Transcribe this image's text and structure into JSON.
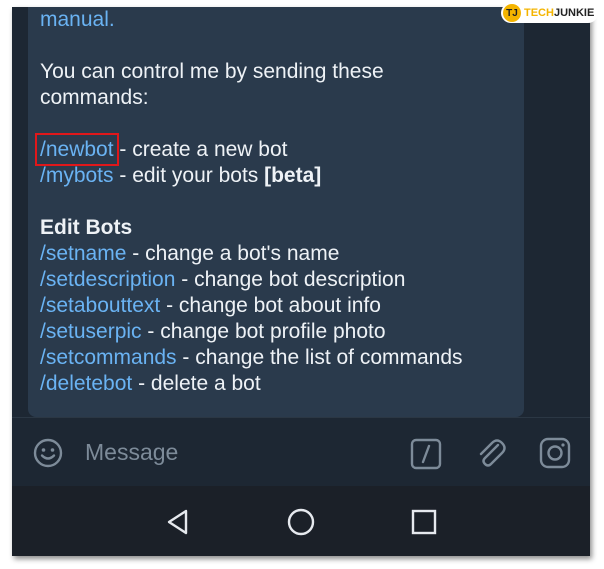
{
  "logo": {
    "badge": "TJ",
    "part1": "TECH",
    "part2": "JUNKIE"
  },
  "message": {
    "top_line": "manual.",
    "intro_line1": "You can control me by sending these",
    "intro_line2": "commands:",
    "commands_main": [
      {
        "cmd": "/newbot",
        "sep": " - ",
        "desc": "create a new bot",
        "extra": ""
      },
      {
        "cmd": "/mybots",
        "sep": " - ",
        "desc": "edit your bots ",
        "extra": "[beta]"
      }
    ],
    "edit_heading": "Edit Bots",
    "edit_commands": [
      {
        "cmd": "/setname",
        "sep": " - ",
        "desc": "change a bot's name"
      },
      {
        "cmd": "/setdescription",
        "sep": " - ",
        "desc": "change bot description"
      },
      {
        "cmd": "/setabouttext",
        "sep": " - ",
        "desc": "change bot about info"
      },
      {
        "cmd": "/setuserpic",
        "sep": " - ",
        "desc": "change bot profile photo"
      },
      {
        "cmd": "/setcommands",
        "sep": " - ",
        "desc": "change the list of commands"
      },
      {
        "cmd": "/deletebot",
        "sep": " - ",
        "desc": "delete a bot"
      }
    ]
  },
  "input": {
    "placeholder": "Message",
    "commands_glyph": "/"
  },
  "icons": {
    "emoji": "smiley-icon",
    "commands": "slash-commands-icon",
    "attach": "paperclip-icon",
    "camera": "instagram-camera-icon",
    "back": "back-triangle-icon",
    "home": "home-circle-icon",
    "recents": "recents-square-icon"
  },
  "colors": {
    "link": "#6ab3f3",
    "text": "#eef2f6",
    "highlight": "#e0171a",
    "bubble": "#2a3a4c",
    "background": "#1d2733"
  }
}
